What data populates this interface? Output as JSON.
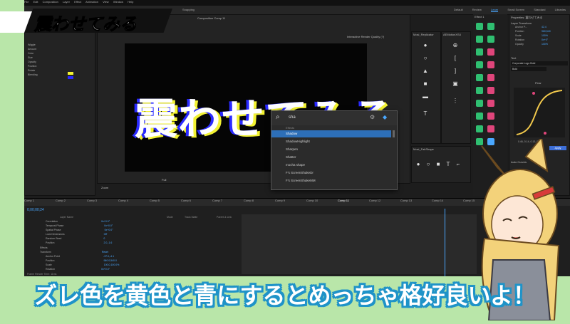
{
  "title_banner": {
    "text": "震わせてみる"
  },
  "subtitle": {
    "text": "ズレ色を黄色と青にするとめっちゃ格好良いよ！"
  },
  "app": {
    "menus": [
      "File",
      "Edit",
      "Composition",
      "Layer",
      "Effect",
      "Animation",
      "View",
      "Window",
      "Help"
    ],
    "workspaces": [
      "Default",
      "Review",
      "Learn",
      "Small Screen",
      "Standard",
      "Libraries"
    ],
    "active_workspace": "Learn",
    "toolbar_snapping": "Snapping",
    "viewer": {
      "tab": "Composition Comp 11",
      "render_quality": "Interactive Render Quality (?)",
      "canvas_text": "震わせてみる",
      "zoom": "Full",
      "tab_timeline": "Zoom"
    },
    "search_popup": {
      "query": "sha",
      "section_label": "Effects",
      "items": [
        "Shadow",
        "ShadowHighlight",
        "Sharpen",
        "Shatter",
        "mocha shape",
        "F's ScreenShakeDr",
        "F's ScreenShakeMM"
      ],
      "selected_index": 0
    },
    "panels": {
      "shapes": "Mosi_Replicator",
      "flow": "AEMotionXS4",
      "fx_panel": "Effect 1",
      "properties": "Properties: 震わせてみる",
      "ease": "Flow",
      "mini_shapes": "Mosi_FakShape",
      "layer_transform": "Layer Transform",
      "text_panel": "Text",
      "font": "Corporate Logo Bold",
      "font_weight": "Bold",
      "curves": "Auto Curves",
      "character": "Character",
      "ease_value": "0.46, 0.14, 0.13, 0.98",
      "apply": "Apply"
    },
    "properties": [
      {
        "label": "Anchor P...",
        "value": "42.4"
      },
      {
        "label": "Position",
        "value": "960,540"
      },
      {
        "label": "Scale",
        "value": "100%"
      },
      {
        "label": "Rotation",
        "value": "0x+0°"
      },
      {
        "label": "Opacity",
        "value": "100%"
      }
    ],
    "effect_controls": [
      "Wiggle",
      "Amount",
      "Color",
      "Size",
      "Opacity",
      "Position",
      "Rotate",
      "Blending"
    ],
    "timeline": {
      "timecode": "0;00;00;24",
      "comps": [
        "Comp 1",
        "Comp 2",
        "Comp 3",
        "Comp 4",
        "Comp 5",
        "Comp 6",
        "Comp 7",
        "Comp 8",
        "Comp 9",
        "Comp 10",
        "Comp 11",
        "Comp 12",
        "Comp 13",
        "Comp 14",
        "Comp 15"
      ],
      "active_comp": "Comp 11",
      "columns": [
        "Layer Name",
        "Mode",
        "Track Matte",
        "Parent & Link"
      ],
      "rows": [
        {
          "name": "Correlation",
          "value": "0x+0.0°"
        },
        {
          "name": "Temporal Phase",
          "value": "0x+0.0°"
        },
        {
          "name": "Spatial Phase",
          "value": "0x+0.0°"
        },
        {
          "name": "Lock Dimensions",
          "value": "Off"
        },
        {
          "name": "Random Seed",
          "value": "0"
        },
        {
          "name": "Position",
          "value": "2.0,-1.6"
        },
        {
          "name": "Effects",
          "value": ""
        },
        {
          "name": "Transform",
          "value": "Reset"
        },
        {
          "name": "Anchor Point",
          "value": "-37.0,-4.1"
        },
        {
          "name": "Position",
          "value": "960.0,540.0"
        },
        {
          "name": "Scale",
          "value": "100.0,100.0%"
        },
        {
          "name": "Rotation",
          "value": "0x+0.0°"
        },
        {
          "name": "Opacity",
          "value": "100%"
        }
      ],
      "footer": "Frame Render Time: 11ms"
    }
  },
  "colors": {
    "accent": "#4aa8ff",
    "canvas_yellow": "#f2f232",
    "canvas_blue": "#2a2aff",
    "subtitle_outline": "#1f93c8",
    "background": "#b9e6a9"
  }
}
